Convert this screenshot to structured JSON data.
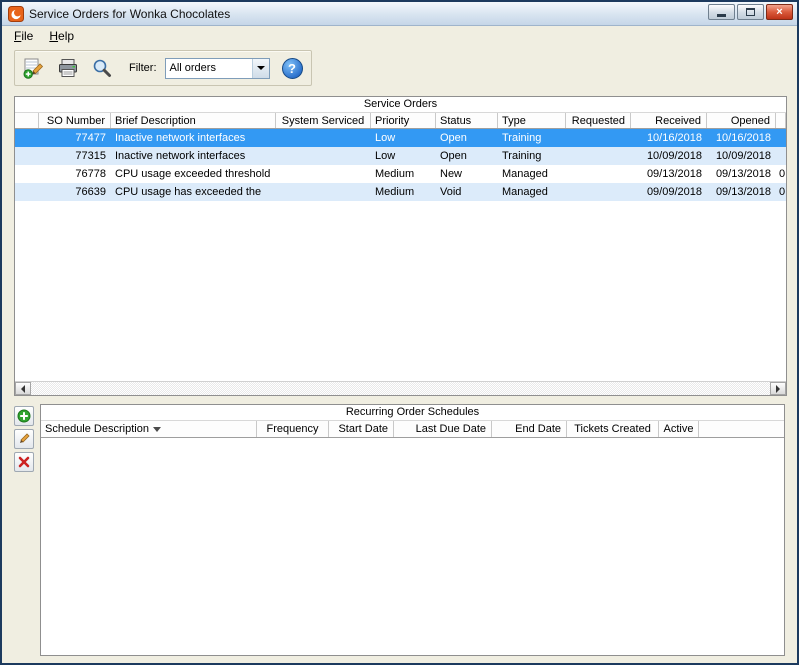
{
  "window": {
    "title": "Service Orders for Wonka Chocolates"
  },
  "menu": {
    "items": [
      {
        "label": "File"
      },
      {
        "label": "Help"
      }
    ]
  },
  "toolbar": {
    "filter_label": "Filter:",
    "filter_value": "All orders",
    "help_glyph": "?"
  },
  "icons": {
    "app": "app-icon",
    "new_order": "new-order-icon",
    "print": "print-icon",
    "search": "search-icon",
    "help": "help-icon",
    "combo_arrow": "chevron-down-icon",
    "sort_desc": "sort-descending-icon",
    "add": "add-icon",
    "edit": "edit-icon",
    "delete": "delete-icon",
    "scroll_left": "scroll-left-icon",
    "scroll_right": "scroll-right-icon",
    "minimize": "minimize-icon",
    "maximize": "maximize-icon",
    "close": "close-icon"
  },
  "service_orders": {
    "title": "Service Orders",
    "columns": [
      "SO Number",
      "Brief Description",
      "System Serviced",
      "Priority",
      "Status",
      "Type",
      "Requested",
      "Received",
      "Opened"
    ],
    "selected_row": 0,
    "rows": [
      [
        "77477",
        "Inactive network interfaces",
        "",
        "Low",
        "Open",
        "Training",
        "",
        "10/16/2018",
        "10/16/2018",
        ""
      ],
      [
        "77315",
        "Inactive network interfaces",
        "",
        "Low",
        "Open",
        "Training",
        "",
        "10/09/2018",
        "10/09/2018",
        ""
      ],
      [
        "76778",
        "CPU usage exceeded threshold",
        "",
        "Medium",
        "New",
        "Managed",
        "",
        "09/13/2018",
        "09/13/2018",
        "0"
      ],
      [
        "76639",
        "CPU usage has exceeded the",
        "",
        "Medium",
        "Void",
        "Managed",
        "",
        "09/09/2018",
        "09/13/2018",
        "0"
      ]
    ]
  },
  "recurring_orders": {
    "title": "Recurring Order Schedules",
    "columns": [
      "Schedule Description",
      "Frequency",
      "Start Date",
      "Last Due Date",
      "End Date",
      "Tickets Created",
      "Active"
    ],
    "sort_column": "Schedule Description",
    "rows": []
  },
  "colors": {
    "selected_row": "#3399F3",
    "alt_row": "#DCEBFA",
    "close_button": "#BE3318",
    "help_button": "#2E74CE"
  }
}
